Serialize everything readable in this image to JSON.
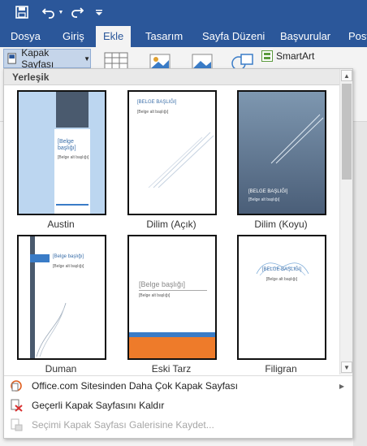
{
  "ribbon_tabs": [
    "Dosya",
    "Giriş",
    "Ekle",
    "Tasarım",
    "Sayfa Düzeni",
    "Başvurular",
    "Post"
  ],
  "active_tab": "Ekle",
  "cover_button_label": "Kapak Sayfası",
  "smartart_label": "SmartArt",
  "gallery": {
    "section_header": "Yerleşik",
    "items": [
      {
        "name": "Austin",
        "title": "[Belge başlığı]",
        "subtitle": "[Belge alt başlığı]"
      },
      {
        "name": "Dilim (Açık)",
        "title": "[BELGE BAŞLIĞI]",
        "subtitle": "[Belge alt başlığı]"
      },
      {
        "name": "Dilim (Koyu)",
        "title": "[BELGE BAŞLIĞI]",
        "subtitle": "[Belge alt başlığı]"
      },
      {
        "name": "Duman",
        "title": "[Belge başlığı]",
        "subtitle": "[Belge alt başlığı]"
      },
      {
        "name": "Eski Tarz",
        "title": "[Belge başlığı]",
        "subtitle": "[Belge alt başlığı]"
      },
      {
        "name": "Filigran",
        "title": "[BELGE BAŞLIĞI]",
        "subtitle": "[Belge alt başlığı]"
      }
    ]
  },
  "menu": {
    "more_online": "Office.com Sitesinden Daha Çok Kapak Sayfası",
    "remove": "Geçerli Kapak Sayfasını Kaldır",
    "save_selection": "Seçimi Kapak Sayfası Galerisine Kaydet..."
  },
  "colors": {
    "ribbon_blue": "#2b579a",
    "austin_blue": "#bcd6f0",
    "dark_slate": "#4a5a6e",
    "eski_orange": "#ee7b2a"
  }
}
